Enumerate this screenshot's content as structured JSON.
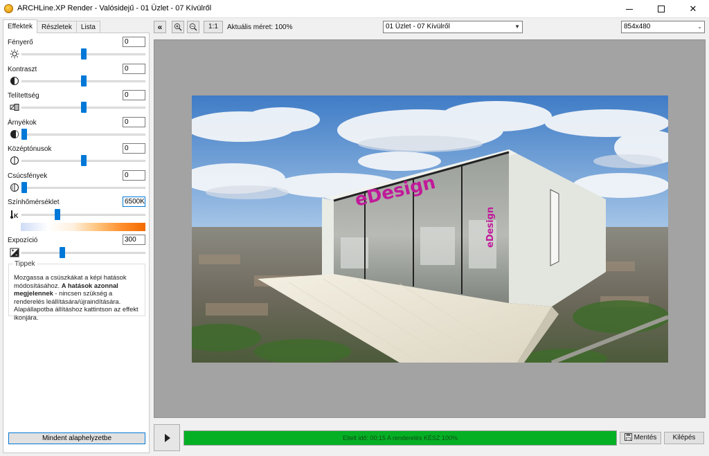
{
  "window": {
    "title": "ARCHLine.XP Render - Valósidejű - 01 Üzlet - 07 Kívülről",
    "icons": {
      "minimize": "minimize-icon",
      "maximize": "maximize-icon",
      "close": "close-icon"
    }
  },
  "tabs": [
    {
      "label": "Effektek",
      "active": true
    },
    {
      "label": "Részletek",
      "active": false
    },
    {
      "label": "Lista",
      "active": false
    }
  ],
  "effects": [
    {
      "label": "Fényerő",
      "value": "0",
      "icon": "brightness-icon",
      "slider": 0.5
    },
    {
      "label": "Kontraszt",
      "value": "0",
      "icon": "contrast-icon",
      "slider": 0.5
    },
    {
      "label": "Telítettség",
      "value": "0",
      "icon": "saturation-icon",
      "slider": 0.5
    },
    {
      "label": "Árnyékok",
      "value": "0",
      "icon": "shadows-icon",
      "slider": 0.0
    },
    {
      "label": "Középtónusok",
      "value": "0",
      "icon": "midtones-icon",
      "slider": 0.5
    },
    {
      "label": "Csúcsfények",
      "value": "0",
      "icon": "highlights-icon",
      "slider": 0.0
    },
    {
      "label": "Színhőmérséklet",
      "value": "6500K",
      "icon": "kelvin-icon",
      "slider": 0.28
    },
    {
      "label": "Expozíció",
      "value": "300",
      "icon": "exposure-icon",
      "slider": 0.32
    }
  ],
  "tips": {
    "title": "Tippek",
    "text_1": "Mozgassa a csúszkákat a képi hatások módosításához. ",
    "text_bold": "A hatások azonnal megjelennek",
    "text_2": " - nincsen szükség a renderelés leállítására/újraindítására. Alapállapotba állításhoz kattintson az effekt ikonjára."
  },
  "reset_button": "Mindent alaphelyzetbe",
  "toolbar": {
    "collapse_icon": "double-chevron-left-icon",
    "zoom_in_icon": "zoom-in-icon",
    "zoom_out_icon": "zoom-out-icon",
    "one_to_one": "1:1",
    "zoom_label": "Aktuális méret: 100%",
    "view_select": "01 Üzlet - 07 Kívülről",
    "resolution_select": "854x480"
  },
  "render": {
    "sign_text": "eDesign",
    "side_sign_text": "eDesign",
    "colors": {
      "sky_top": "#3f7cc6",
      "sky_bottom": "#a9c8e8",
      "sign": "#c01a9a"
    }
  },
  "status": {
    "progress_text": "Eltelt idő: 00:15  A renderelés KÉSZ  100%",
    "progress": 1.0,
    "progress_color": "#06b025"
  },
  "buttons": {
    "save": "Mentés",
    "save_icon": "save-icon",
    "exit": "Kilépés",
    "play_icon": "play-icon"
  }
}
